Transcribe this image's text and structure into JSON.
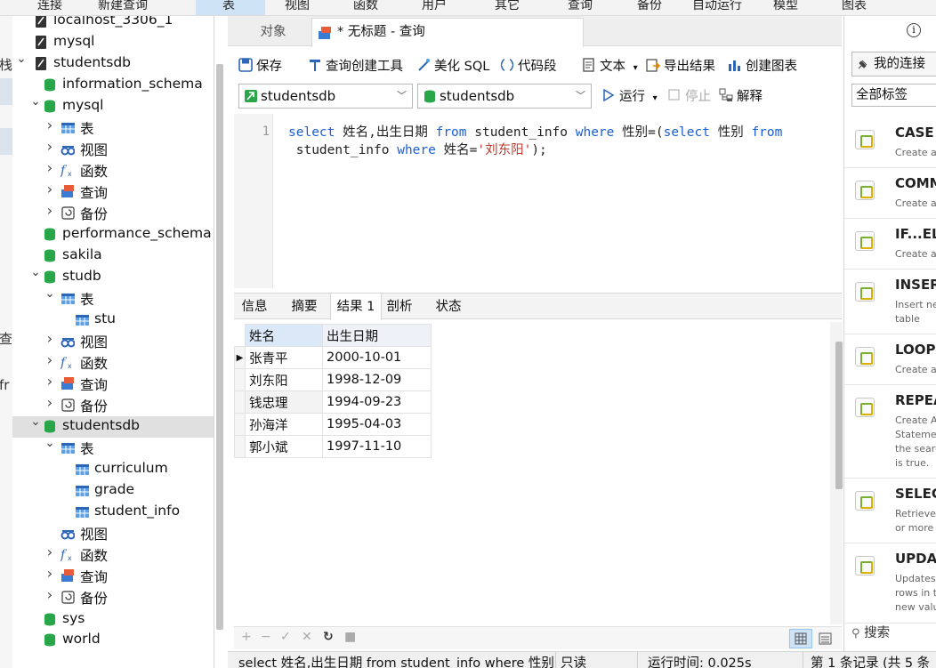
{
  "menu": [
    "连接",
    "新建查询",
    "表",
    "视图",
    "函数",
    "用户",
    "其它",
    "查询",
    "备份",
    "自动运行",
    "模型",
    "图表"
  ],
  "left_strip": [
    "栈",
    "查",
    "fr"
  ],
  "tree": {
    "items": [
      {
        "label": "localhost_3306_1",
        "icon": "server-icon"
      },
      {
        "label": "mysql",
        "icon": "server-icon"
      },
      {
        "label": "studentsdb",
        "icon": "server-icon"
      },
      {
        "label": "information_schema",
        "icon": "database-icon"
      },
      {
        "label": "mysql",
        "icon": "database-icon"
      },
      {
        "label": "表",
        "icon": "table-folder-icon"
      },
      {
        "label": "视图",
        "icon": "view-icon"
      },
      {
        "label": "函数",
        "icon": "function-icon"
      },
      {
        "label": "查询",
        "icon": "query-icon"
      },
      {
        "label": "备份",
        "icon": "backup-icon"
      },
      {
        "label": "performance_schema",
        "icon": "database-icon"
      },
      {
        "label": "sakila",
        "icon": "database-icon"
      },
      {
        "label": "studb",
        "icon": "database-icon"
      },
      {
        "label": "表",
        "icon": "table-folder-icon"
      },
      {
        "label": "stu",
        "icon": "table-icon"
      },
      {
        "label": "视图",
        "icon": "view-icon"
      },
      {
        "label": "函数",
        "icon": "function-icon"
      },
      {
        "label": "查询",
        "icon": "query-icon"
      },
      {
        "label": "备份",
        "icon": "backup-icon"
      },
      {
        "label": "studentsdb",
        "icon": "database-icon"
      },
      {
        "label": "表",
        "icon": "table-folder-icon"
      },
      {
        "label": "curriculum",
        "icon": "table-icon"
      },
      {
        "label": "grade",
        "icon": "table-icon"
      },
      {
        "label": "student_info",
        "icon": "table-icon"
      },
      {
        "label": "视图",
        "icon": "view-icon"
      },
      {
        "label": "函数",
        "icon": "function-icon"
      },
      {
        "label": "查询",
        "icon": "query-icon"
      },
      {
        "label": "备份",
        "icon": "backup-icon"
      },
      {
        "label": "sys",
        "icon": "database-icon"
      },
      {
        "label": "world",
        "icon": "database-icon"
      }
    ]
  },
  "tabs": {
    "objects": "对象",
    "query": "* 无标题 - 查询"
  },
  "toolbar": {
    "save": "保存",
    "builder": "查询创建工具",
    "beautify": "美化 SQL",
    "snippet": "代码段",
    "text": "文本",
    "export": "导出结果",
    "chart": "创建图表"
  },
  "run_bar": {
    "connection": "studentsdb",
    "database": "studentsdb",
    "run": "运行",
    "stop": "停止",
    "explain": "解释"
  },
  "editor": {
    "line": "1"
  },
  "result_tabs": [
    "信息",
    "摘要",
    "结果 1",
    "剖析",
    "状态"
  ],
  "result": {
    "columns": [
      "姓名",
      "出生日期"
    ],
    "rows": [
      [
        "张青平",
        "2000-10-01"
      ],
      [
        "刘东阳",
        "1998-12-09"
      ],
      [
        "钱忠理",
        "1994-09-23"
      ],
      [
        "孙海洋",
        "1995-04-03"
      ],
      [
        "郭小斌",
        "1997-11-10"
      ]
    ]
  },
  "status": {
    "sql": "select 姓名,出生日期 from student_info where 性别",
    "readonly": "只读",
    "time": "运行时间: 0.025s",
    "records": "第 1 条记录 (共 5 条"
  },
  "right_panel": {
    "my_connection": "我的连接",
    "all_tags": "全部标签",
    "snippets": [
      {
        "title": "CASE",
        "desc": "Create a"
      },
      {
        "title": "COMM",
        "desc": "Create a"
      },
      {
        "title": "IF...ELS",
        "desc": "Create a"
      },
      {
        "title": "INSERT",
        "desc": "Insert new table"
      },
      {
        "title": "LOOP",
        "desc": "Create a"
      },
      {
        "title": "REPEA",
        "desc": "Create A Statemen the searc is true."
      },
      {
        "title": "SELECT",
        "desc": "Retrieve r or more t"
      },
      {
        "title": "UPDAT",
        "desc": "Updates rows in th new valu"
      }
    ],
    "search": "搜索"
  },
  "colors": {
    "accent": "#1a5fd6",
    "db_green": "#2aa64a",
    "string_red": "#c0392b"
  }
}
